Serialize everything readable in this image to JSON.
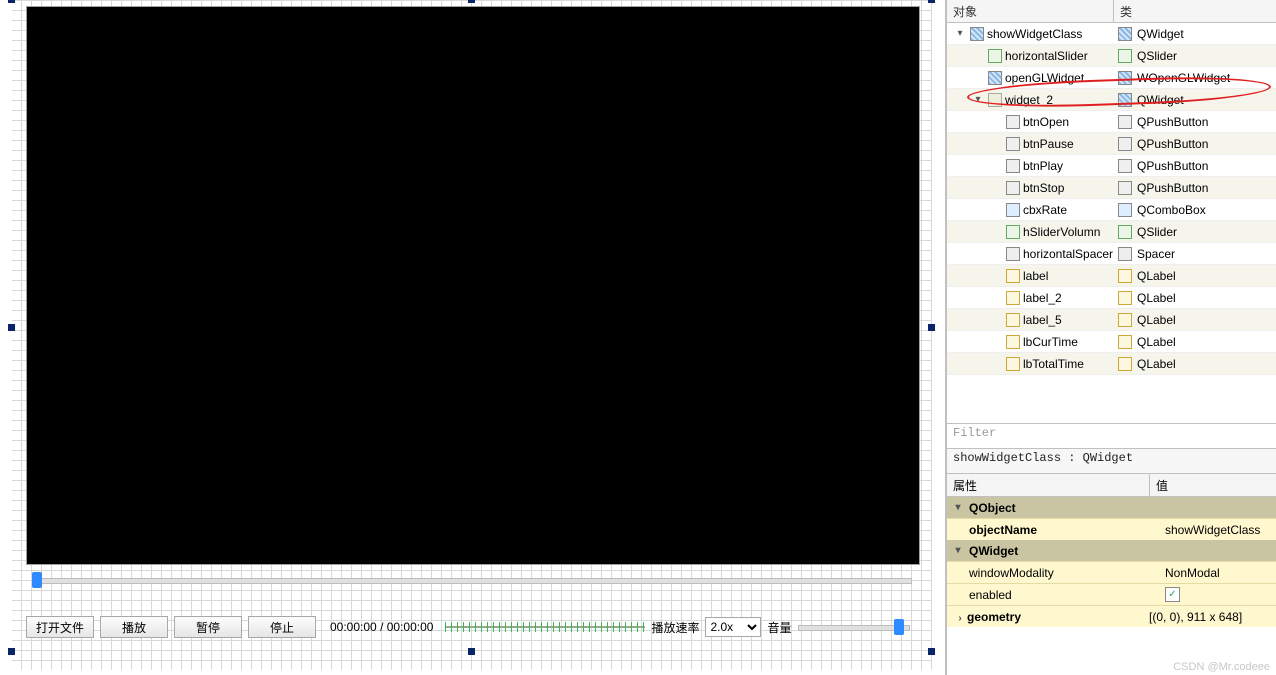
{
  "designer": {
    "buttons": {
      "openFile": "打开文件",
      "play": "播放",
      "pause": "暂停",
      "stop": "停止"
    },
    "time": {
      "current": "00:00:00",
      "sep": "/",
      "total": "00:00:00"
    },
    "labels": {
      "rateLabel": "播放速率",
      "volumeLabel": "音量"
    },
    "rateSelected": "2.0x"
  },
  "objectTree": {
    "headers": {
      "object": "对象",
      "class": "类"
    },
    "rows": [
      {
        "depth": 0,
        "twist": "▾",
        "icon": "hatch",
        "name": "showWidgetClass",
        "cls": "QWidget",
        "cicon": "hatch"
      },
      {
        "depth": 1,
        "twist": "",
        "icon": "slider",
        "name": "horizontalSlider",
        "cls": "QSlider",
        "cicon": "slider"
      },
      {
        "depth": 1,
        "twist": "",
        "icon": "hatch",
        "name": "openGLWidget",
        "cls": "WOpenGLWidget",
        "cicon": "hatch",
        "circled": true
      },
      {
        "depth": 1,
        "twist": "▾",
        "icon": "vbox",
        "name": "widget_2",
        "cls": "QWidget",
        "cicon": "hatch"
      },
      {
        "depth": 2,
        "twist": "",
        "icon": "btn",
        "name": "btnOpen",
        "cls": "QPushButton",
        "cicon": "btn"
      },
      {
        "depth": 2,
        "twist": "",
        "icon": "btn",
        "name": "btnPause",
        "cls": "QPushButton",
        "cicon": "btn"
      },
      {
        "depth": 2,
        "twist": "",
        "icon": "btn",
        "name": "btnPlay",
        "cls": "QPushButton",
        "cicon": "btn"
      },
      {
        "depth": 2,
        "twist": "",
        "icon": "btn",
        "name": "btnStop",
        "cls": "QPushButton",
        "cicon": "btn"
      },
      {
        "depth": 2,
        "twist": "",
        "icon": "combo",
        "name": "cbxRate",
        "cls": "QComboBox",
        "cicon": "combo"
      },
      {
        "depth": 2,
        "twist": "",
        "icon": "slider",
        "name": "hSliderVolumn",
        "cls": "QSlider",
        "cicon": "slider"
      },
      {
        "depth": 2,
        "twist": "",
        "icon": "spacer",
        "name": "horizontalSpacer",
        "cls": "Spacer",
        "cicon": "spacer"
      },
      {
        "depth": 2,
        "twist": "",
        "icon": "label",
        "name": "label",
        "cls": "QLabel",
        "cicon": "label"
      },
      {
        "depth": 2,
        "twist": "",
        "icon": "label",
        "name": "label_2",
        "cls": "QLabel",
        "cicon": "label"
      },
      {
        "depth": 2,
        "twist": "",
        "icon": "label",
        "name": "label_5",
        "cls": "QLabel",
        "cicon": "label"
      },
      {
        "depth": 2,
        "twist": "",
        "icon": "label",
        "name": "lbCurTime",
        "cls": "QLabel",
        "cicon": "label"
      },
      {
        "depth": 2,
        "twist": "",
        "icon": "label",
        "name": "lbTotalTime",
        "cls": "QLabel",
        "cicon": "label"
      }
    ]
  },
  "filterPlaceholder": "Filter",
  "classLine": "showWidgetClass : QWidget",
  "propertyPanel": {
    "headers": {
      "prop": "属性",
      "val": "值"
    },
    "groups": [
      {
        "label": "QObject",
        "rows": [
          {
            "name": "objectName",
            "value": "showWidgetClass",
            "bold": true
          }
        ]
      },
      {
        "label": "QWidget",
        "rows": [
          {
            "name": "windowModality",
            "value": "NonModal"
          },
          {
            "name": "enabled",
            "value": "check"
          },
          {
            "name": "geometry",
            "value": "[(0, 0), 911 x 648]",
            "bold": true,
            "twist": "›"
          }
        ]
      }
    ]
  },
  "watermark": "CSDN @Mr.codeee"
}
